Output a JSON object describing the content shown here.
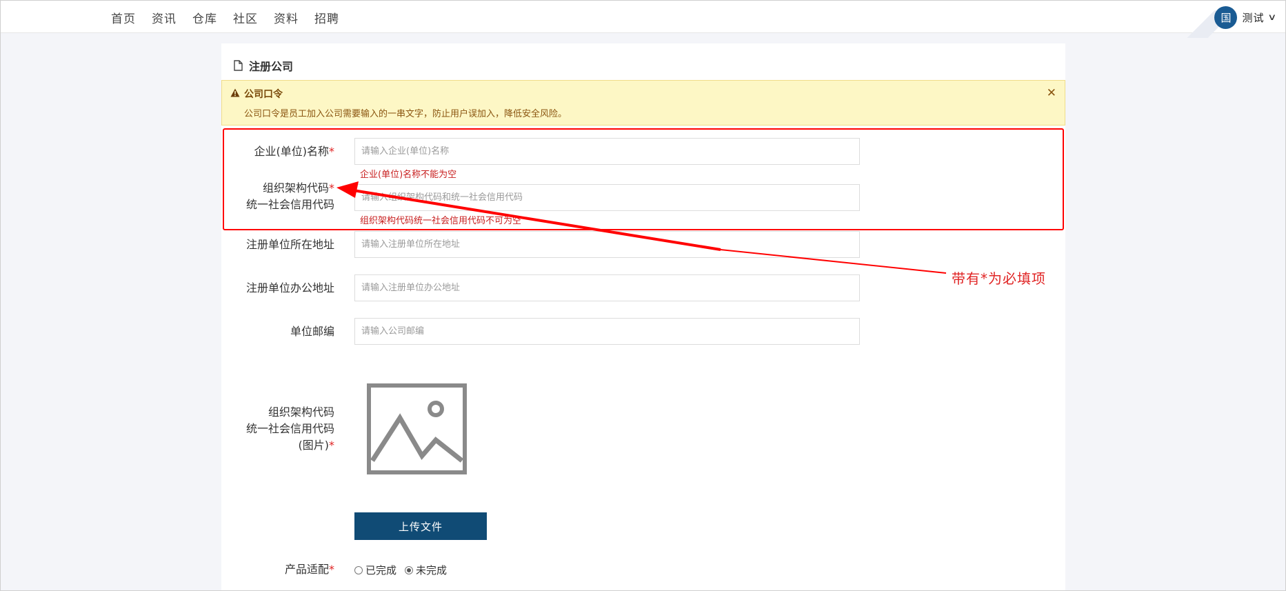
{
  "nav": {
    "items": [
      "首页",
      "资讯",
      "仓库",
      "社区",
      "资料",
      "招聘"
    ]
  },
  "user": {
    "avatar_text": "国",
    "name": "测试"
  },
  "card": {
    "title": "注册公司"
  },
  "alert": {
    "title": "公司口令",
    "body": "公司口令是员工加入公司需要输入的一串文字，防止用户误加入，降低安全风险。",
    "close": "✕"
  },
  "form": {
    "company_name": {
      "label": "企业(单位)名称",
      "required": "*",
      "placeholder": "请输入企业(单位)名称",
      "error": "企业(单位)名称不能为空"
    },
    "org_code": {
      "label_line1": "组织架构代码",
      "required": "*",
      "label_line2": "统一社会信用代码",
      "placeholder": "请输入组织架构代码和统一社会信用代码",
      "error": "组织架构代码统一社会信用代码不可为空"
    },
    "reg_address": {
      "label": "注册单位所在地址",
      "placeholder": "请输入注册单位所在地址"
    },
    "office_address": {
      "label": "注册单位办公地址",
      "placeholder": "请输入注册单位办公地址"
    },
    "postcode": {
      "label": "单位邮编",
      "placeholder": "请输入公司邮编"
    },
    "code_image": {
      "label_line1": "组织架构代码",
      "label_line2": "统一社会信用代码",
      "label_line3": "(图片)",
      "required": "*"
    },
    "upload_button": "上传文件",
    "product_fit": {
      "label": "产品适配",
      "required": "*",
      "options": [
        "已完成",
        "未完成"
      ],
      "selected": "未完成"
    }
  },
  "annotation": {
    "text": "带有*为必填项",
    "color": "#e02424"
  }
}
